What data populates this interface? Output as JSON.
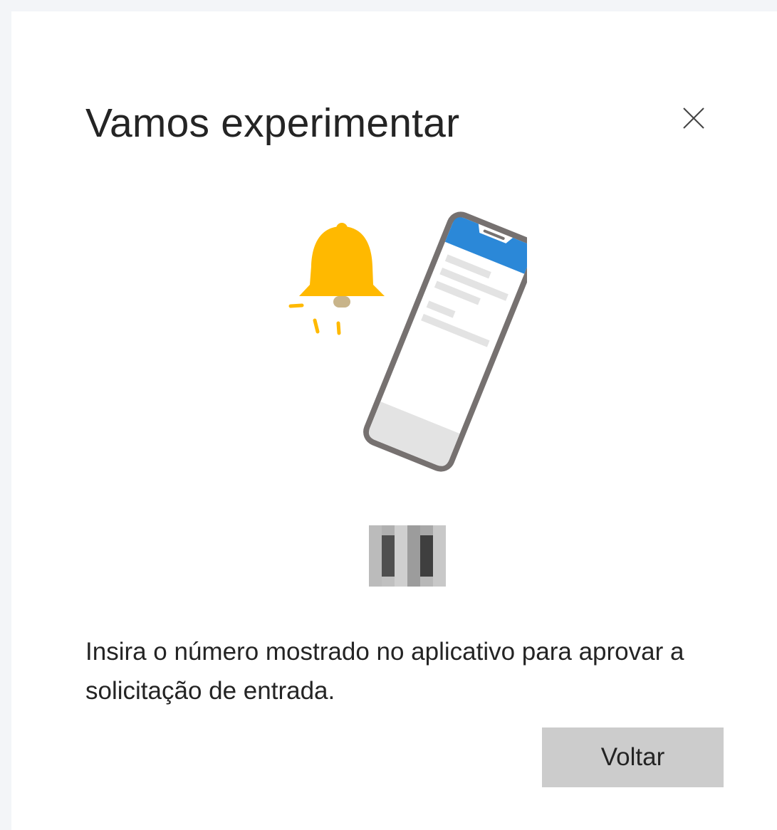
{
  "dialog": {
    "title": "Vamos experimentar",
    "close_icon": "close-icon",
    "illustration_icons": [
      "bell-icon",
      "phone-icon"
    ],
    "number_display": "",
    "message": "Insira o número mostrado no aplicativo para aprovar a solicitação de entrada.",
    "back_label": "Voltar"
  },
  "colors": {
    "bell": "#ffb900",
    "phone_frame": "#767170",
    "phone_header": "#2b88d8",
    "button_bg": "#cccccc",
    "text": "#242424"
  }
}
